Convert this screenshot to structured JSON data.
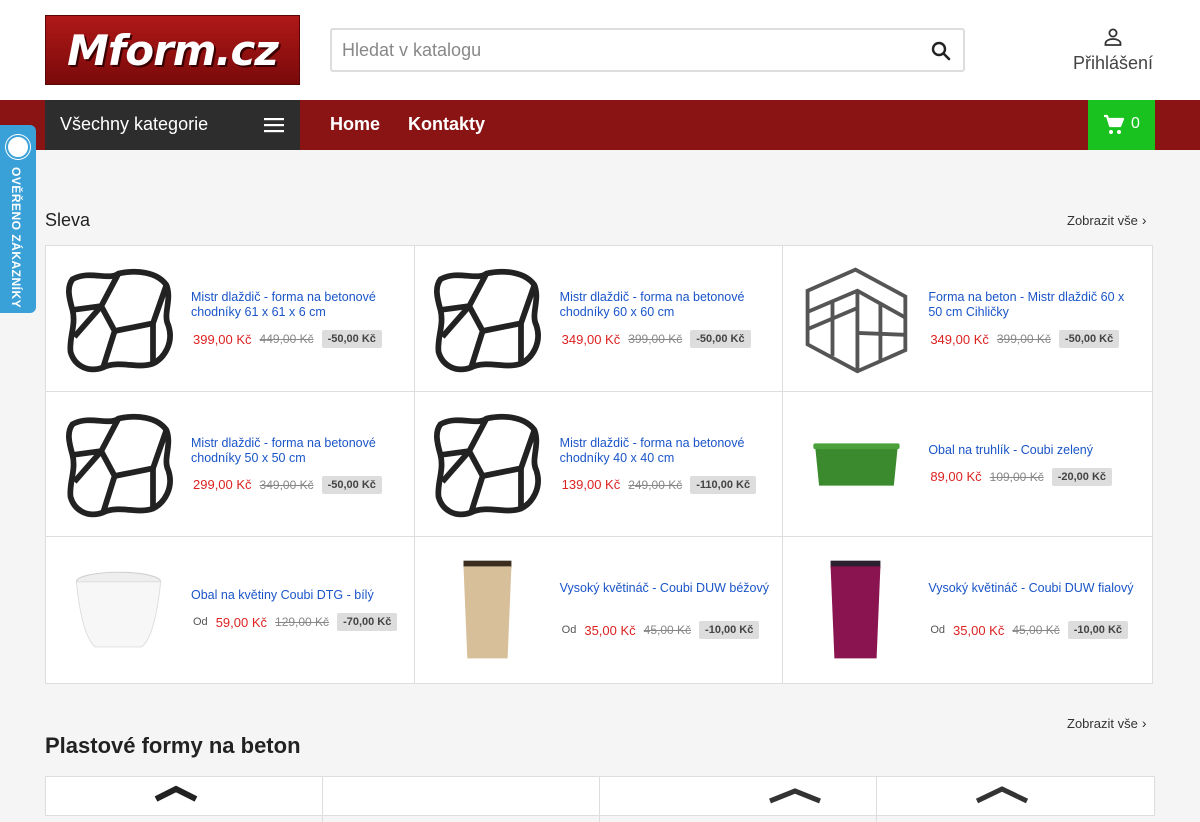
{
  "header": {
    "logo_text": "Mform.cz",
    "search_placeholder": "Hledat v katalogu",
    "login_label": "Přihlášení"
  },
  "nav": {
    "categories_label": "Všechny kategorie",
    "links": [
      "Home",
      "Kontakty"
    ],
    "cart_count": "0"
  },
  "badge": {
    "text": "OVĚŘENO ZÁKAZNÍKY"
  },
  "sale_section": {
    "title": "Sleva",
    "show_all": "Zobrazit vše",
    "products": [
      {
        "name": "Mistr dlaždič - forma na betonové chodníky 61 x 61 x 6 cm",
        "prefix": "",
        "price": "399,00 Kč",
        "old_price": "449,00 Kč",
        "discount": "-50,00 Kč",
        "image": "paving-mold"
      },
      {
        "name": "Mistr dlaždič - forma na betonové chodníky 60 x 60 cm",
        "prefix": "",
        "price": "349,00 Kč",
        "old_price": "399,00 Kč",
        "discount": "-50,00 Kč",
        "image": "paving-mold"
      },
      {
        "name": "Forma na beton - Mistr dlaždič 60 x 50 cm Cihličky",
        "prefix": "",
        "price": "349,00 Kč",
        "old_price": "399,00 Kč",
        "discount": "-50,00 Kč",
        "image": "brick-mold"
      },
      {
        "name": "Mistr dlaždič - forma na betonové chodníky 50 x 50 cm",
        "prefix": "",
        "price": "299,00 Kč",
        "old_price": "349,00 Kč",
        "discount": "-50,00 Kč",
        "image": "paving-mold"
      },
      {
        "name": "Mistr dlaždič - forma na betonové chodníky 40 x 40 cm",
        "prefix": "",
        "price": "139,00 Kč",
        "old_price": "249,00 Kč",
        "discount": "-110,00 Kč",
        "image": "paving-mold"
      },
      {
        "name": "Obal na truhlík - Coubi zelený",
        "prefix": "",
        "price": "89,00 Kč",
        "old_price": "109,00 Kč",
        "discount": "-20,00 Kč",
        "image": "green-planter"
      },
      {
        "name": "Obal na květiny Coubi DTG - bílý",
        "prefix": "Od",
        "price": "59,00 Kč",
        "old_price": "129,00 Kč",
        "discount": "-70,00 Kč",
        "image": "white-pot"
      },
      {
        "name": "Vysoký květináč - Coubi DUW béžový",
        "prefix": "Od",
        "price": "35,00 Kč",
        "old_price": "45,00 Kč",
        "discount": "-10,00 Kč",
        "image": "beige-tall-pot"
      },
      {
        "name": "Vysoký květináč - Coubi DUW fialový",
        "prefix": "Od",
        "price": "35,00 Kč",
        "old_price": "45,00 Kč",
        "discount": "-10,00 Kč",
        "image": "purple-tall-pot"
      }
    ]
  },
  "forms_section": {
    "title": "Plastové formy na beton",
    "show_all": "Zobrazit vše"
  },
  "colors": {
    "brand_red": "#8a1414",
    "cart_green": "#19c21f",
    "price_red": "#dd2222",
    "link_blue": "#1a55c8",
    "badge_blue": "#3aa0d8"
  }
}
